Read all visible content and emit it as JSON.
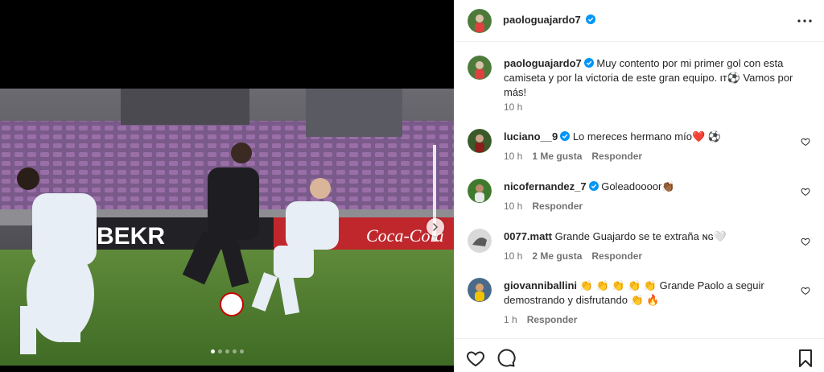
{
  "post": {
    "author": "paologuajardo7",
    "caption_author": "paologuajardo7",
    "caption_text": "Muy contento por mi primer gol con esta camiseta y por la victoria de este gran equipo. ιт⚽️ Vamos por más!",
    "caption_time": "10 h",
    "carousel": {
      "total": 5,
      "active_index": 0
    }
  },
  "comments": [
    {
      "user": "luciano__9",
      "verified": true,
      "text": "Lo mereces hermano mío❤️ ⚽️",
      "time": "10 h",
      "likes": "1 Me gusta",
      "reply": "Responder"
    },
    {
      "user": "nicofernandez_7",
      "verified": true,
      "text": "Goleadoooor👏🏾",
      "time": "10 h",
      "likes": "",
      "reply": "Responder"
    },
    {
      "user": "0077.matt",
      "verified": false,
      "text": "Grande Guajardo se te extraña ɴɢ🤍",
      "time": "10 h",
      "likes": "2 Me gusta",
      "reply": "Responder"
    },
    {
      "user": "giovanniballini",
      "verified": false,
      "text": "👏 👏 👏 👏 👏 Grande Paolo a seguir demostrando y disfrutando 👏 🔥",
      "time": "1 h",
      "likes": "",
      "reply": "Responder"
    }
  ],
  "icons": {
    "verified": "verified-badge-icon",
    "more": "more-options-icon",
    "like": "heart-icon",
    "comment": "comment-icon",
    "save": "bookmark-icon",
    "next": "chevron-right-icon"
  },
  "colors": {
    "verified": "#0095f6",
    "text": "#262626",
    "muted": "#737373",
    "border": "#efefef"
  }
}
